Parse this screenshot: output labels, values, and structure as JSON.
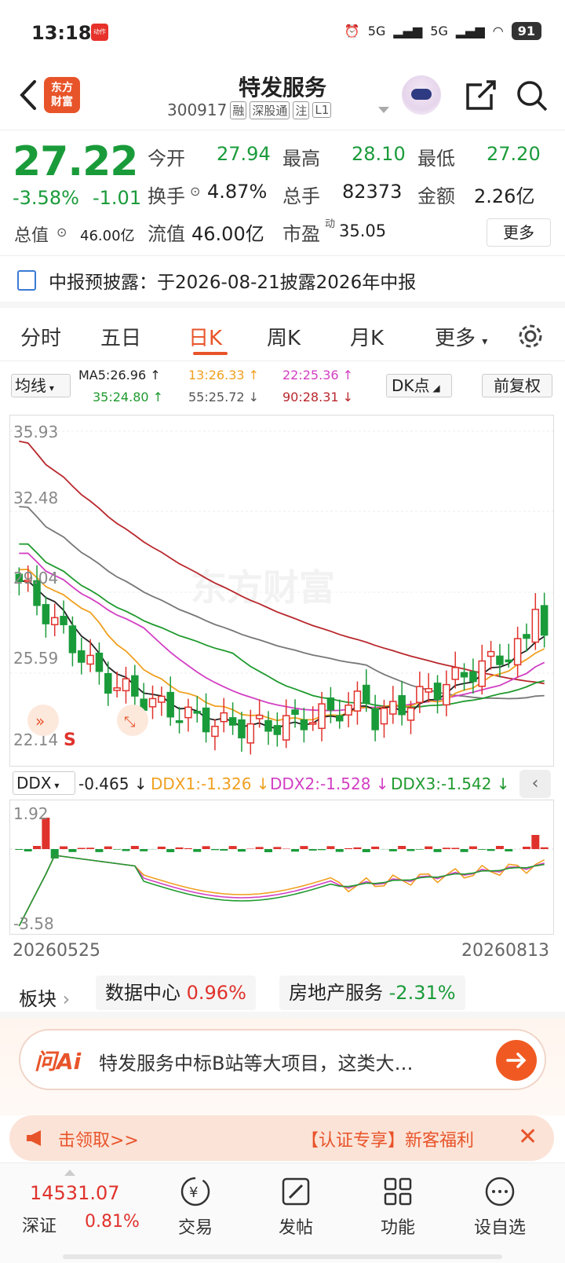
{
  "status_bar": {
    "time": "13:18",
    "app_badge": "动作",
    "signal1": "5G",
    "signal2": "5G",
    "battery": "91"
  },
  "header": {
    "logo_line1": "东方",
    "logo_line2": "财富",
    "stock_name": "特发服务",
    "stock_code": "300917",
    "tags": [
      "融",
      "深股通",
      "注",
      "L1"
    ]
  },
  "quote": {
    "price": "27.22",
    "change_pct": "-3.58%",
    "change_val": "-1.01",
    "open_label": "今开",
    "open": "27.94",
    "high_label": "最高",
    "high": "28.10",
    "low_label": "最低",
    "low": "27.20",
    "turnover_label": "换手",
    "turnover": "4.87%",
    "volume_label": "总手",
    "volume": "82373",
    "amount_label": "金额",
    "amount": "2.26亿",
    "mktcap_label": "总值",
    "mktcap": "46.00亿",
    "float_label": "流值",
    "float_cap": "46.00亿",
    "pe_label": "市盈",
    "pe_sup": "动",
    "pe": "35.05",
    "more_label": "更多"
  },
  "notice": {
    "text": "中报预披露：于2026-08-21披露2026年中报"
  },
  "tabs": [
    "分时",
    "五日",
    "日K",
    "周K",
    "月K",
    "更多"
  ],
  "ma_legend": {
    "select": "均线",
    "ma5": "MA5:26.96 ↑",
    "ma13": "13:26.33 ↑",
    "ma22": "22:25.36 ↑",
    "ma35": "35:24.80 ↑",
    "ma55": "55:25.72 ↓",
    "ma90": "90:28.31 ↓",
    "dk_select": "DK点",
    "fq_button": "前复权",
    "colors": {
      "ma5": "#222222",
      "ma13": "#f0a020",
      "ma22": "#d23fc3",
      "ma35": "#1f9a2e",
      "ma55": "#777777",
      "ma90": "#b8282d"
    }
  },
  "kline_axis": {
    "labels": [
      "35.93",
      "32.48",
      "29.04",
      "25.59",
      "22.14"
    ],
    "s_marker": "S",
    "watermark": "东方财富"
  },
  "ddx": {
    "select": "DDX",
    "value": "-0.465 ↓",
    "ddx1": "DDX1:-1.326 ↓",
    "ddx2": "DDX2:-1.528 ↓",
    "ddx3": "DDX3:-1.542 ↓",
    "top_label": "1.92",
    "bottom_label": "-3.58"
  },
  "dates": {
    "start": "20260525",
    "end": "20260813"
  },
  "sector": {
    "label": "板块",
    "items": [
      {
        "name": "数据中心",
        "pct": "0.96%"
      },
      {
        "name": "房地产服务",
        "pct": "-2.31%"
      }
    ]
  },
  "ai": {
    "logo": "问Ai",
    "text": "特发服务中标B站等大项目，这类大…"
  },
  "promo": {
    "left": "击领取>>",
    "right": "【认证专享】新客福利"
  },
  "bottom_nav": {
    "index_value": "14531.07",
    "index_name": "深证",
    "index_pct": "0.81%",
    "items": [
      "交易",
      "发帖",
      "功能",
      "设自选"
    ]
  }
}
